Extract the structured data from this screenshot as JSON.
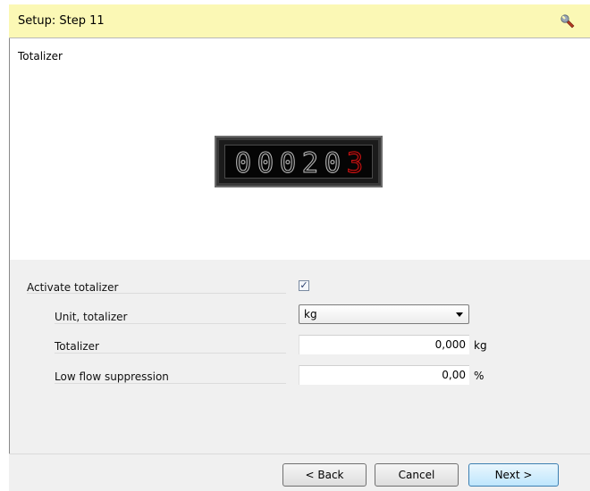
{
  "header": {
    "title": "Setup: Step 11",
    "icon": "wrench-icon"
  },
  "section": {
    "title": "Totalizer"
  },
  "display": {
    "digits": [
      "0",
      "0",
      "0",
      "2",
      "0",
      "3"
    ],
    "active_digit_color": "#d21414"
  },
  "form": {
    "activate": {
      "label": "Activate totalizer",
      "checked": true,
      "check_glyph": "✓"
    },
    "unit": {
      "label": "Unit, totalizer",
      "value": "kg"
    },
    "totalizer": {
      "label": "Totalizer",
      "value": "0,000",
      "unit": "kg"
    },
    "low_flow": {
      "label": "Low flow suppression",
      "value": "0,00",
      "unit": "%"
    }
  },
  "buttons": {
    "back": "< Back",
    "cancel": "Cancel",
    "next": "Next >"
  },
  "colors": {
    "header_bg": "#fbf8b5",
    "panel_bg": "#f0f0f0"
  }
}
